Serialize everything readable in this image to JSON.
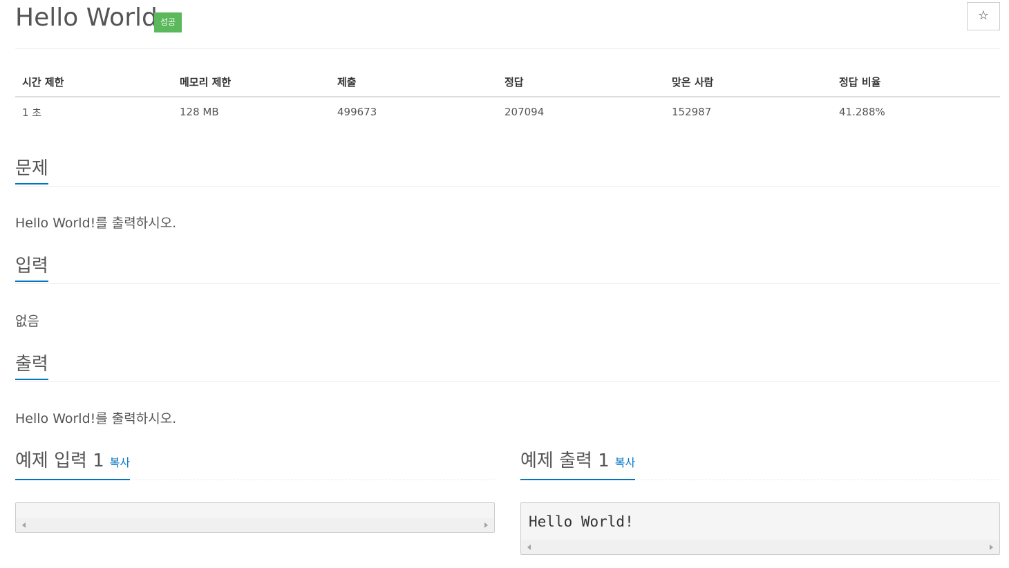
{
  "header": {
    "title": "Hello World",
    "badge": "성공",
    "star_icon": "☆"
  },
  "stats": {
    "headers": [
      "시간 제한",
      "메모리 제한",
      "제출",
      "정답",
      "맞은 사람",
      "정답 비율"
    ],
    "values": [
      "1 초",
      "128 MB",
      "499673",
      "207094",
      "152987",
      "41.288%"
    ]
  },
  "problem": {
    "heading": "문제",
    "text": "Hello World!를 출력하시오."
  },
  "input": {
    "heading": "입력",
    "text": "없음"
  },
  "output": {
    "heading": "출력",
    "text": "Hello World!를 출력하시오."
  },
  "sample_input": {
    "heading": "예제 입력 1",
    "copy_label": "복사",
    "content": ""
  },
  "sample_output": {
    "heading": "예제 출력 1",
    "copy_label": "복사",
    "content": "Hello World!"
  },
  "colors": {
    "badge": "#5cb85c",
    "accent": "#0076c0"
  }
}
